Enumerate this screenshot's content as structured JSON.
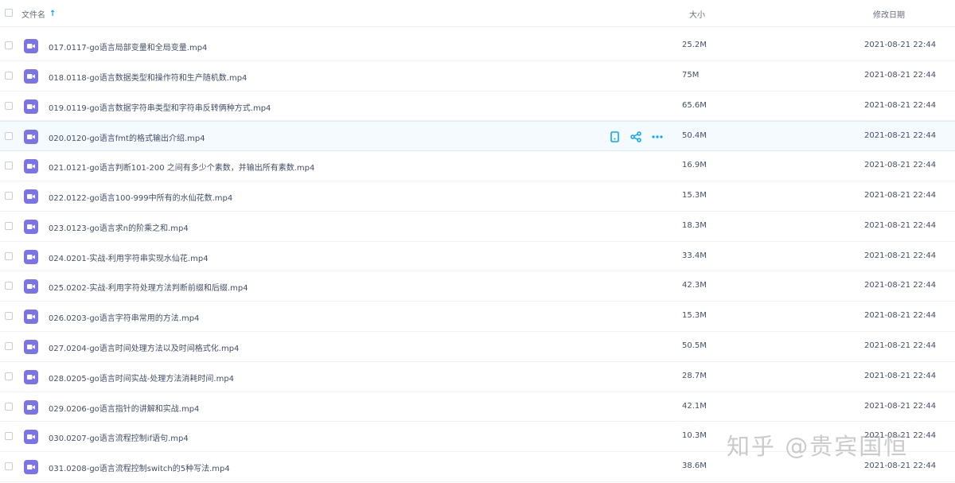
{
  "header": {
    "name_label": "文件名",
    "sort_icon": "arrow-up-icon",
    "size_label": "大小",
    "date_label": "修改日期"
  },
  "accent_color": "#06a7ff",
  "file_icon_color": "#7b73e8",
  "files": [
    {
      "name": "017.0117-go语言局部变量和全局变量.mp4",
      "size": "25.2M",
      "date": "2021-08-21 22:44"
    },
    {
      "name": "018.0118-go语言数据类型和操作符和生产随机数.mp4",
      "size": "75M",
      "date": "2021-08-21 22:44"
    },
    {
      "name": "019.0119-go语言数据字符串类型和字符串反转俩种方式.mp4",
      "size": "65.6M",
      "date": "2021-08-21 22:44"
    },
    {
      "name": "020.0120-go语言fmt的格式输出介绍.mp4",
      "size": "50.4M",
      "date": "2021-08-21 22:44",
      "hover": true
    },
    {
      "name": "021.0121-go语言判断101-200 之间有多少个素数，并输出所有素数.mp4",
      "size": "16.9M",
      "date": "2021-08-21 22:44"
    },
    {
      "name": "022.0122-go语言100-999中所有的水仙花数.mp4",
      "size": "15.3M",
      "date": "2021-08-21 22:44"
    },
    {
      "name": "023.0123-go语言求n的阶乘之和.mp4",
      "size": "18.3M",
      "date": "2021-08-21 22:44"
    },
    {
      "name": "024.0201-实战-利用字符串实现水仙花.mp4",
      "size": "33.4M",
      "date": "2021-08-21 22:44"
    },
    {
      "name": "025.0202-实战-利用字符处理方法判断前缀和后缀.mp4",
      "size": "42.3M",
      "date": "2021-08-21 22:44"
    },
    {
      "name": "026.0203-go语言字符串常用的方法.mp4",
      "size": "15.3M",
      "date": "2021-08-21 22:44"
    },
    {
      "name": "027.0204-go语言时间处理方法以及时间格式化.mp4",
      "size": "50.5M",
      "date": "2021-08-21 22:44"
    },
    {
      "name": "028.0205-go语言时间实战-处理方法消耗时间.mp4",
      "size": "28.7M",
      "date": "2021-08-21 22:44"
    },
    {
      "name": "029.0206-go语言指针的讲解和实战.mp4",
      "size": "42.1M",
      "date": "2021-08-21 22:44"
    },
    {
      "name": "030.0207-go语言流程控制if语句.mp4",
      "size": "10.3M",
      "date": "2021-08-21 22:44"
    },
    {
      "name": "031.0208-go语言流程控制switch的5种写法.mp4",
      "size": "38.6M",
      "date": "2021-08-21 22:44"
    }
  ],
  "row_actions": [
    "phone-icon",
    "share-icon",
    "more-icon"
  ],
  "watermark": "知乎 @贵宾国恒"
}
